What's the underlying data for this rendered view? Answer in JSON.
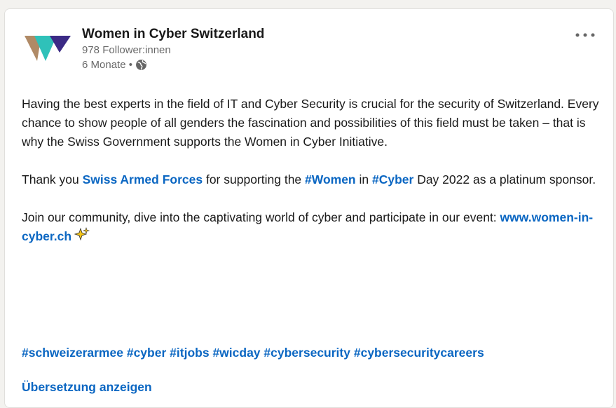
{
  "post": {
    "author_name": "Women in Cyber Switzerland",
    "followers": "978 Follower:innen",
    "age": "6 Monate •",
    "visibility_icon": "globe-icon",
    "more_icon": "more-horizontal-icon",
    "paragraph1": "Having the best experts in the field of IT and Cyber Security is crucial for the security of Switzerland. Every chance to show people of all genders the fascination and possibilities of this field must be taken – that is why the Swiss Government supports the Women in Cyber Initiative.",
    "paragraph2": {
      "part1": "Thank you ",
      "mention": "Swiss Armed Forces",
      "part2": " for supporting the ",
      "tag1": "#Women",
      "part3": " in ",
      "tag2": "#Cyber",
      "part4": " Day 2022 as a platinum sponsor."
    },
    "paragraph3": {
      "text": "Join our community, dive into the captivating world of cyber and participate in our event: ",
      "link": "www.women-in-cyber.ch",
      "emoji_icon": "sparkles-icon"
    },
    "hashtags": [
      "#schweizerarmee",
      "#cyber",
      "#itjobs",
      "#wicday",
      "#cybersecurity",
      "#cybersecuritycareers"
    ],
    "translate_label": "Übersetzung anzeigen"
  },
  "colors": {
    "link": "#0a66c2",
    "logo_purple": "#3b2a85",
    "logo_teal": "#2fc1b9",
    "logo_tan": "#b08a66"
  }
}
